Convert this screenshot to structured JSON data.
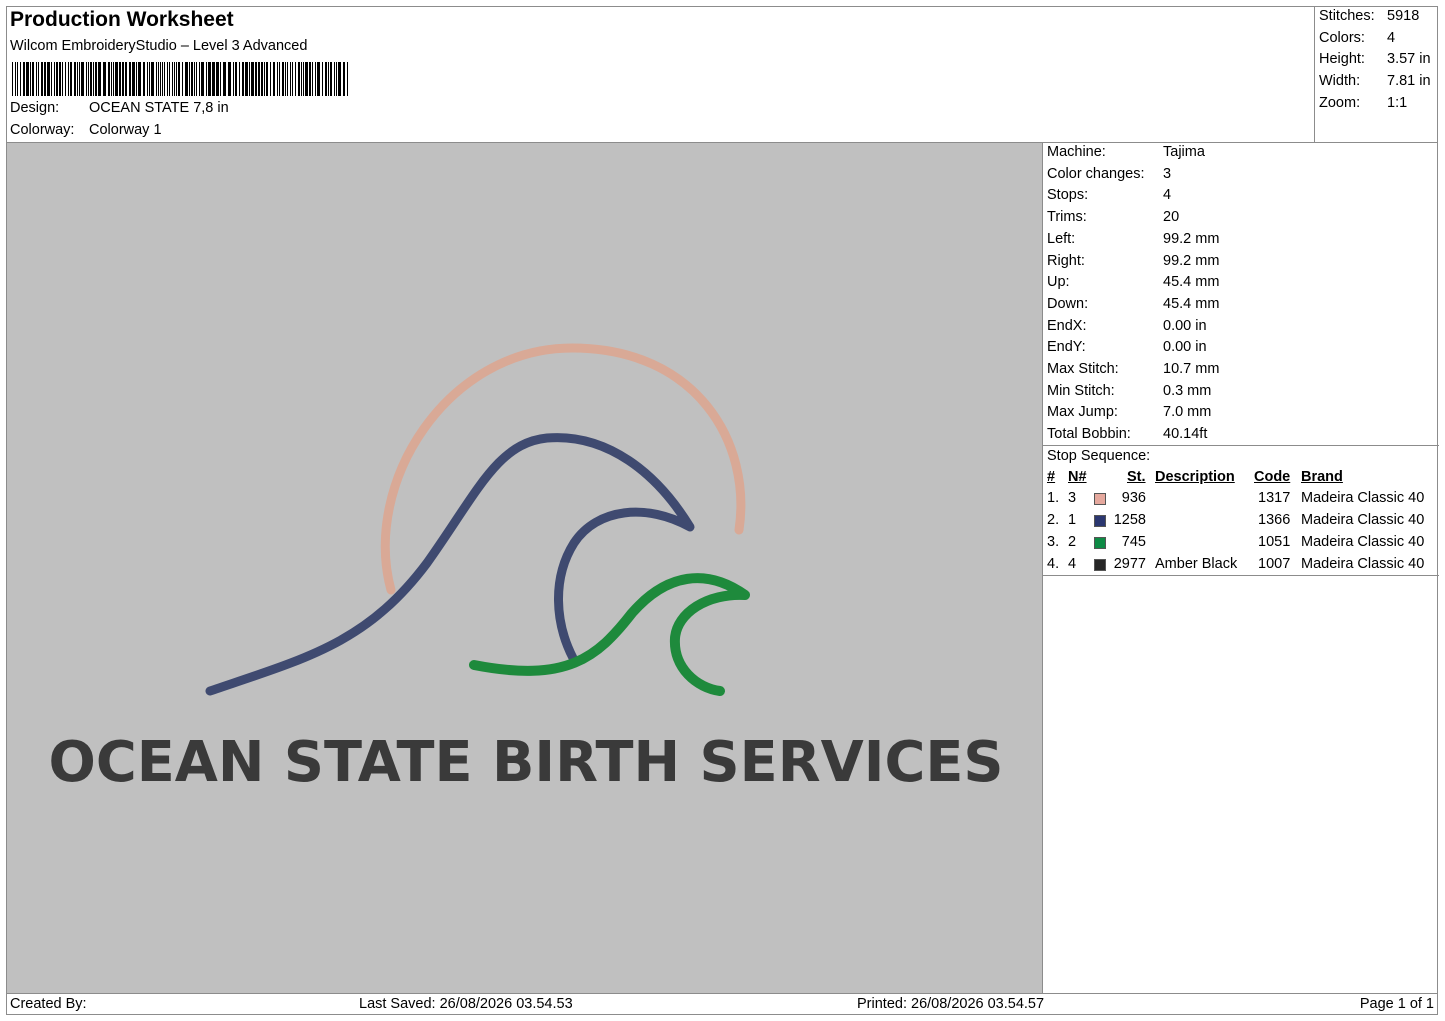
{
  "header": {
    "title": "Production Worksheet",
    "software": "Wilcom EmbroideryStudio – Level 3 Advanced",
    "barcode_label": "barcode",
    "design_label": "Design:",
    "design_value": "OCEAN STATE 7,8 in",
    "colorway_label": "Colorway:",
    "colorway_value": "Colorway 1"
  },
  "stats": {
    "stitches_label": "Stitches:",
    "stitches": "5918",
    "colors_label": "Colors:",
    "colors": "4",
    "height_label": "Height:",
    "height": "3.57 in",
    "width_label": "Width:",
    "width": "7.81 in",
    "zoom_label": "Zoom:",
    "zoom": "1:1"
  },
  "design": {
    "text": "OCEAN STATE BIRTH SERVICES",
    "thread_colors": {
      "sun": "#d9a996",
      "wave": "#3f4a70",
      "small_wave": "#1e8a3c",
      "text": "#3a3a3a",
      "background": "#c0c0c0"
    }
  },
  "machine": {
    "rows": [
      {
        "label": "Machine:",
        "value": "Tajima"
      },
      {
        "label": "Color changes:",
        "value": "3"
      },
      {
        "label": "Stops:",
        "value": "4"
      },
      {
        "label": "Trims:",
        "value": "20"
      },
      {
        "label": "Left:",
        "value": "99.2 mm"
      },
      {
        "label": "Right:",
        "value": "99.2 mm"
      },
      {
        "label": "Up:",
        "value": "45.4 mm"
      },
      {
        "label": "Down:",
        "value": "45.4 mm"
      },
      {
        "label": "EndX:",
        "value": "0.00 in"
      },
      {
        "label": "EndY:",
        "value": "0.00 in"
      },
      {
        "label": "Max Stitch:",
        "value": "10.7 mm"
      },
      {
        "label": "Min Stitch:",
        "value": "0.3 mm"
      },
      {
        "label": "Max Jump:",
        "value": "7.0 mm"
      },
      {
        "label": "Total Bobbin:",
        "value": "40.14ft"
      }
    ]
  },
  "stop_sequence": {
    "title": "Stop Sequence:",
    "headers": {
      "num": "#",
      "n": "N#",
      "st": "St.",
      "desc": "Description",
      "code": "Code",
      "brand": "Brand"
    },
    "rows": [
      {
        "num": "1.",
        "n": "3",
        "color": "#e5a89d",
        "st": "936",
        "desc": "",
        "code": "1317",
        "brand": "Madeira Classic 40"
      },
      {
        "num": "2.",
        "n": "1",
        "color": "#2b3770",
        "st": "1258",
        "desc": "",
        "code": "1366",
        "brand": "Madeira Classic 40"
      },
      {
        "num": "3.",
        "n": "2",
        "color": "#0e8a45",
        "st": "745",
        "desc": "",
        "code": "1051",
        "brand": "Madeira Classic 40"
      },
      {
        "num": "4.",
        "n": "4",
        "color": "#262626",
        "st": "2977",
        "desc": "Amber Black",
        "code": "1007",
        "brand": "Madeira Classic 40"
      }
    ]
  },
  "footer": {
    "created_by": "Created By:",
    "last_saved": "Last Saved: 26/08/2026 03.54.53",
    "printed": "Printed: 26/08/2026 03.54.57",
    "page": "Page 1 of 1"
  }
}
